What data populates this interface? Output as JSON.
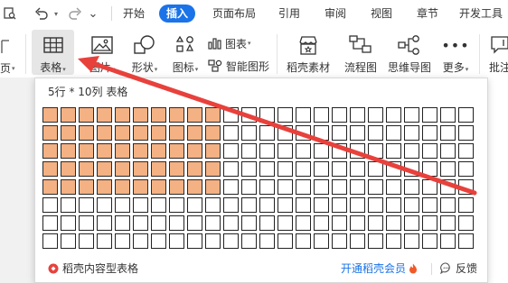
{
  "menubar": {
    "icons": [
      "search-doc-icon",
      "undo-icon",
      "redo-icon"
    ],
    "tabs": [
      {
        "label": "开始",
        "active": false
      },
      {
        "label": "插入",
        "active": true
      },
      {
        "label": "页面布局",
        "active": false
      },
      {
        "label": "引用",
        "active": false
      },
      {
        "label": "审阅",
        "active": false
      },
      {
        "label": "视图",
        "active": false
      },
      {
        "label": "章节",
        "active": false
      },
      {
        "label": "开发工具",
        "active": false
      }
    ]
  },
  "ribbon": {
    "left_cut_label": "页",
    "table": {
      "label": "表格",
      "icon": "table-icon"
    },
    "picture": {
      "label": "图片",
      "icon": "picture-icon"
    },
    "shape": {
      "label": "形状",
      "icon": "shape-icon"
    },
    "icons_btn": {
      "label": "图标",
      "icon": "icons-icon"
    },
    "chart": {
      "label": "图表",
      "icon": "chart-icon"
    },
    "smart_art": {
      "label": "智能图形",
      "icon": "smart-art-icon"
    },
    "material": {
      "label": "稻壳素材",
      "icon": "store-icon"
    },
    "flowchart": {
      "label": "流程图",
      "icon": "flowchart-icon"
    },
    "mindmap": {
      "label": "思维导图",
      "icon": "mindmap-icon"
    },
    "more": {
      "label": "更多",
      "icon": "more-icon"
    },
    "comment": {
      "label": "批注",
      "icon": "comment-icon"
    }
  },
  "table_picker": {
    "title": "5行 * 10列 表格",
    "rows": 8,
    "cols": 24,
    "selected_rows": 5,
    "selected_cols": 10,
    "selected_color": "#f4b183",
    "footer_left": "稻壳内容型表格",
    "footer_mid": "开通稻壳会员",
    "footer_right": "反馈"
  },
  "colors": {
    "accent": "#1a73e8",
    "arrow": "#e8413c"
  }
}
